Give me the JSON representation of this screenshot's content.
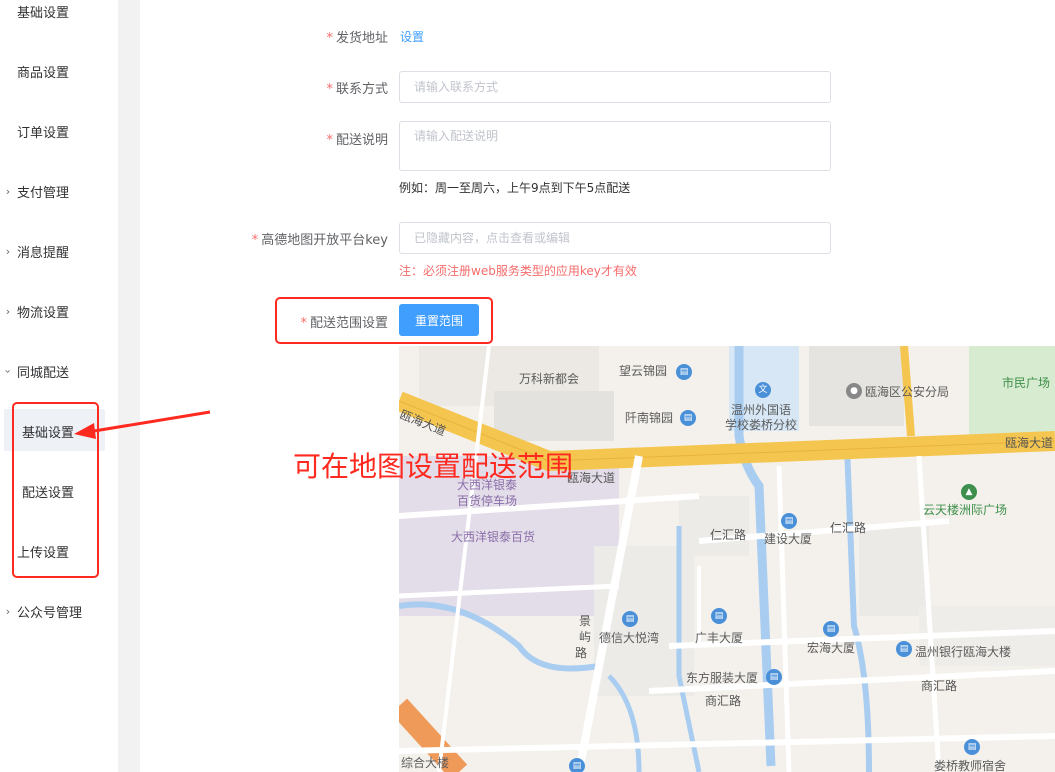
{
  "sidebar": {
    "items": [
      {
        "label": "基础设置",
        "type": "plain"
      },
      {
        "label": "商品设置",
        "type": "plain"
      },
      {
        "label": "订单设置",
        "type": "plain"
      },
      {
        "label": "支付管理",
        "type": "group",
        "chevron": "chevron-right-icon"
      },
      {
        "label": "消息提醒",
        "type": "group",
        "chevron": "chevron-right-icon"
      },
      {
        "label": "物流设置",
        "type": "group",
        "chevron": "chevron-right-icon"
      },
      {
        "label": "同城配送",
        "type": "group",
        "chevron": "chevron-down-icon",
        "expanded": true
      },
      {
        "label": "基础设置",
        "type": "sub",
        "active": true
      },
      {
        "label": "配送设置",
        "type": "sub"
      },
      {
        "label": "上传设置",
        "type": "sub"
      },
      {
        "label": "公众号管理",
        "type": "group",
        "chevron": "chevron-right-icon"
      }
    ]
  },
  "form": {
    "ship_address": {
      "label": "发货地址",
      "link": "设置"
    },
    "contact": {
      "label": "联系方式",
      "placeholder": "请输入联系方式",
      "value": ""
    },
    "delivery_note": {
      "label": "配送说明",
      "placeholder": "请输入配送说明",
      "value": "",
      "hint": "例如：周一至周六，上午9点到下午5点配送"
    },
    "amap_key": {
      "label": "高德地图开放平台key",
      "placeholder": "已隐藏内容，点击查看或编辑",
      "value": "",
      "warning": "注：必须注册web服务类型的应用key才有效"
    },
    "range": {
      "label": "配送范围设置",
      "button": "重置范围"
    }
  },
  "map": {
    "labels": {
      "wanke": "万科新都会",
      "wangyun": "望云锦园",
      "qiannan": "阡南锦园",
      "school1": "温州外国语",
      "school2": "学校娄桥分校",
      "police": "瓯海区公安分局",
      "square": "市民广场",
      "ouhai_road_left": "瓯海大道",
      "ouhai_road_right": "瓯海大道",
      "ouhai_road_mid": "瓯海大道",
      "daxiyang_parking1": "大西洋银泰",
      "daxiyang_parking2": "百货停车场",
      "daxiyang": "大西洋银泰百货",
      "yuntian": "云天楼洲际广场",
      "renhui_road1": "仁汇路",
      "renhui_road2": "仁汇路",
      "jianshe": "建设大厦",
      "jingyu1": "景",
      "jingyu2": "屿",
      "jingyu3": "路",
      "dexin": "德信大悦湾",
      "guangfeng": "广丰大厦",
      "honghai": "宏海大厦",
      "wzbank": "温州银行瓯海大楼",
      "dongfang": "东方服装大厦",
      "shanghui_road1": "商汇路",
      "shanghui_road2": "商汇路",
      "zonghe": "综合大楼",
      "dorm": "娄桥教师宿舍"
    }
  },
  "annotation": {
    "text": "可在地图设置配送范围"
  },
  "colors": {
    "primary": "#409eff",
    "required": "#f56c6c",
    "annotation": "#ff2a1f"
  }
}
